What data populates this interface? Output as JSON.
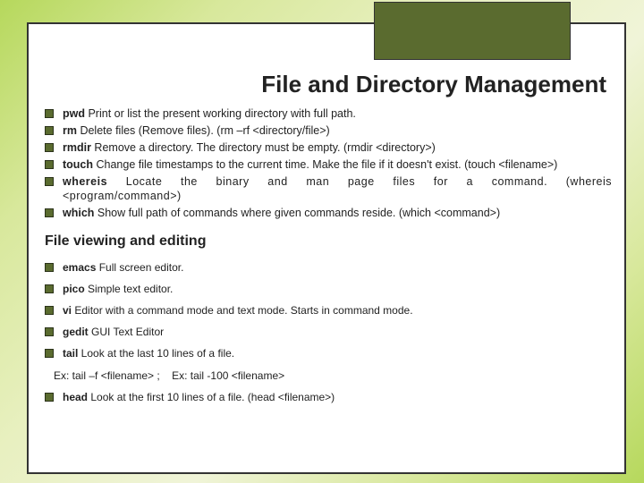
{
  "title": "File and Directory Management",
  "section1": {
    "items": [
      {
        "cmd": "pwd",
        "desc": " Print or list the present working directory with full path."
      },
      {
        "cmd": "rm",
        "desc": " Delete files (Remove files). (rm –rf <directory/file>)"
      },
      {
        "cmd": "rmdir",
        "desc": " Remove a directory. The directory must be empty. (rmdir <directory>)"
      },
      {
        "cmd": "touch",
        "desc": " Change file timestamps to the current time. Make the file if it doesn't exist. (touch <filename>)"
      },
      {
        "cmd": "whereis",
        "desc": " Locate the binary and man page files for a command. (whereis <program/command>)",
        "wide": true
      },
      {
        "cmd": "which",
        "desc": " Show full path of commands where given commands reside. (which <command>)"
      }
    ]
  },
  "section2": {
    "heading": "File viewing and editing",
    "items": [
      {
        "cmd": "emacs",
        "desc": " Full screen editor."
      },
      {
        "cmd": "pico",
        "desc": " Simple text editor."
      },
      {
        "cmd": "vi",
        "desc": " Editor with a command mode and text mode. Starts in command mode."
      },
      {
        "cmd": "gedit",
        "desc": " GUI Text Editor"
      },
      {
        "cmd": "tail",
        "desc": " Look at the last 10 lines of a file."
      }
    ],
    "example": "Ex: tail –f <filename> ;    Ex: tail -100 <filename>",
    "last": {
      "cmd": "head",
      "desc": " Look at the first 10 lines of a file. (head <filename>)"
    }
  }
}
